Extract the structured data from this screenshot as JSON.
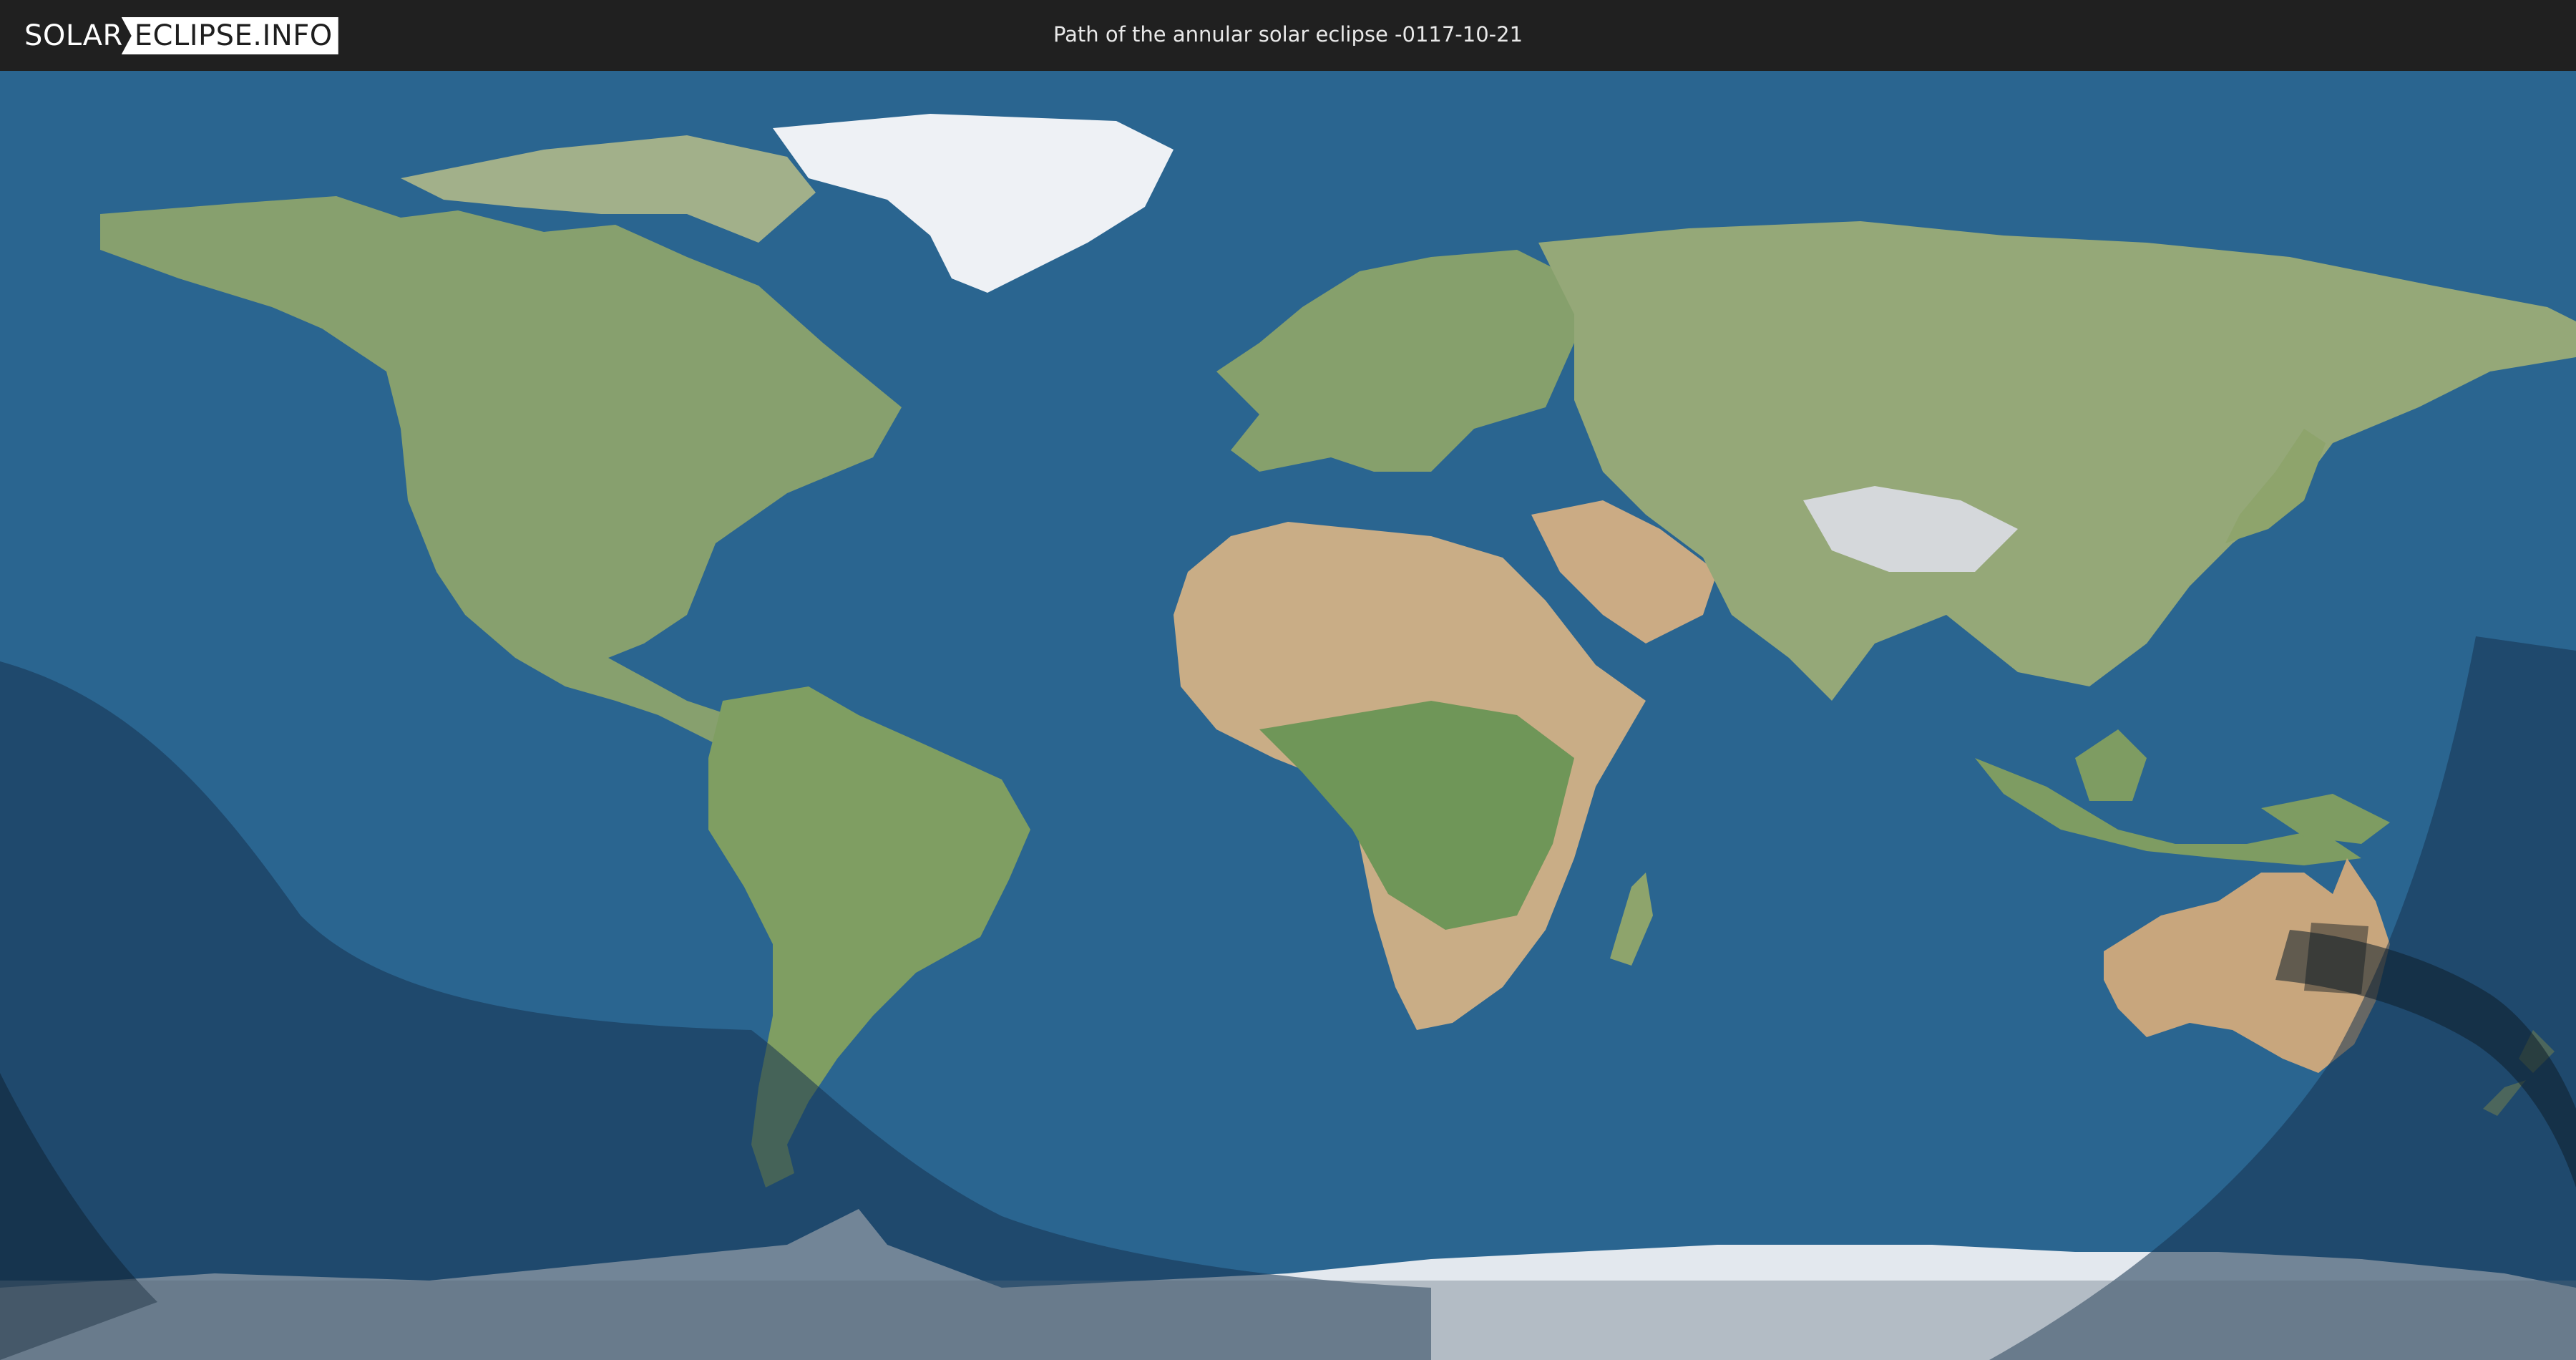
{
  "header": {
    "logo_primary": "SOLAR",
    "logo_secondary": "ECLIPSE.INFO",
    "title": "Path of the annular solar eclipse -0117-10-21"
  },
  "map": {
    "projection": "equirectangular world map",
    "eclipse_type": "annular",
    "date": "-0117-10-21",
    "colors": {
      "ocean": "#2a6590",
      "land": "#8fa572",
      "desert": "#cdb08c",
      "ice": "#e4e9ef",
      "partial_zone": "#1c3f60",
      "outer_zone": "#13283c",
      "central_path": "#1a2a36"
    }
  }
}
